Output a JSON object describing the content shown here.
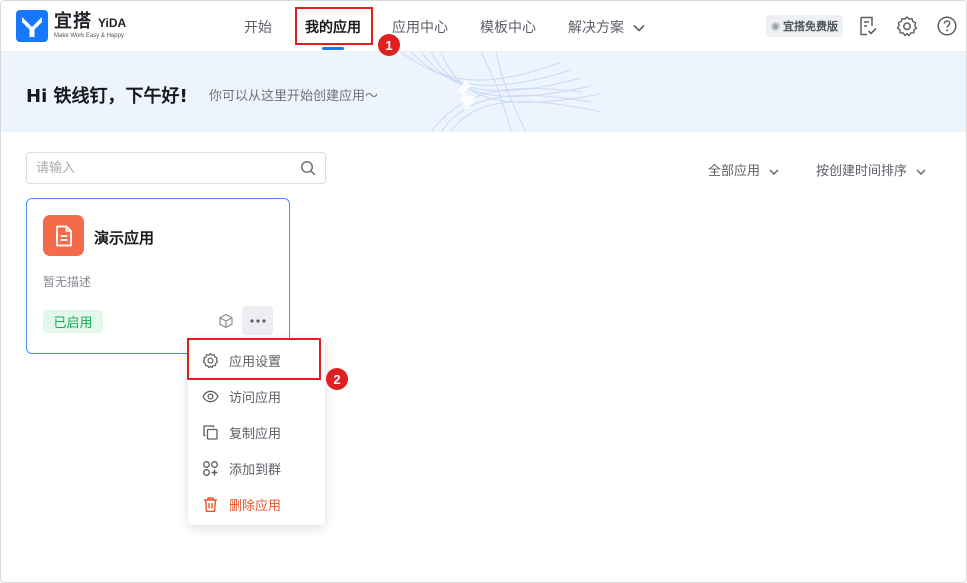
{
  "brand": {
    "name_cn": "宜搭",
    "name_en": "YiDA",
    "slogan": "Make Work Easy & Happy",
    "accent": "#1677ff"
  },
  "nav": {
    "items": [
      {
        "label": "开始"
      },
      {
        "label": "我的应用",
        "active": true
      },
      {
        "label": "应用中心"
      },
      {
        "label": "模板中心"
      },
      {
        "label": "解决方案"
      }
    ]
  },
  "header": {
    "free_badge": "宜搭免费版",
    "icons": [
      "todo-check-icon",
      "gear-icon",
      "help-icon"
    ]
  },
  "banner": {
    "greeting": "Hi 铁线钉，下午好!",
    "subtitle": "你可以从这里开始创建应用～"
  },
  "toolbar": {
    "search_placeholder": "请输入",
    "filter_label": "全部应用",
    "sort_label": "按创建时间排序"
  },
  "apps": [
    {
      "name": "演示应用",
      "description": "暂无描述",
      "status": "已启用",
      "icon_color": "#f46b4a"
    }
  ],
  "menu": {
    "items": [
      {
        "label": "应用设置",
        "icon": "gear-icon"
      },
      {
        "label": "访问应用",
        "icon": "eye-icon"
      },
      {
        "label": "复制应用",
        "icon": "copy-icon"
      },
      {
        "label": "添加到群",
        "icon": "group-add-icon"
      },
      {
        "label": "删除应用",
        "icon": "trash-icon",
        "danger": true
      }
    ]
  },
  "annotations": [
    {
      "number": "1"
    },
    {
      "number": "2"
    }
  ]
}
